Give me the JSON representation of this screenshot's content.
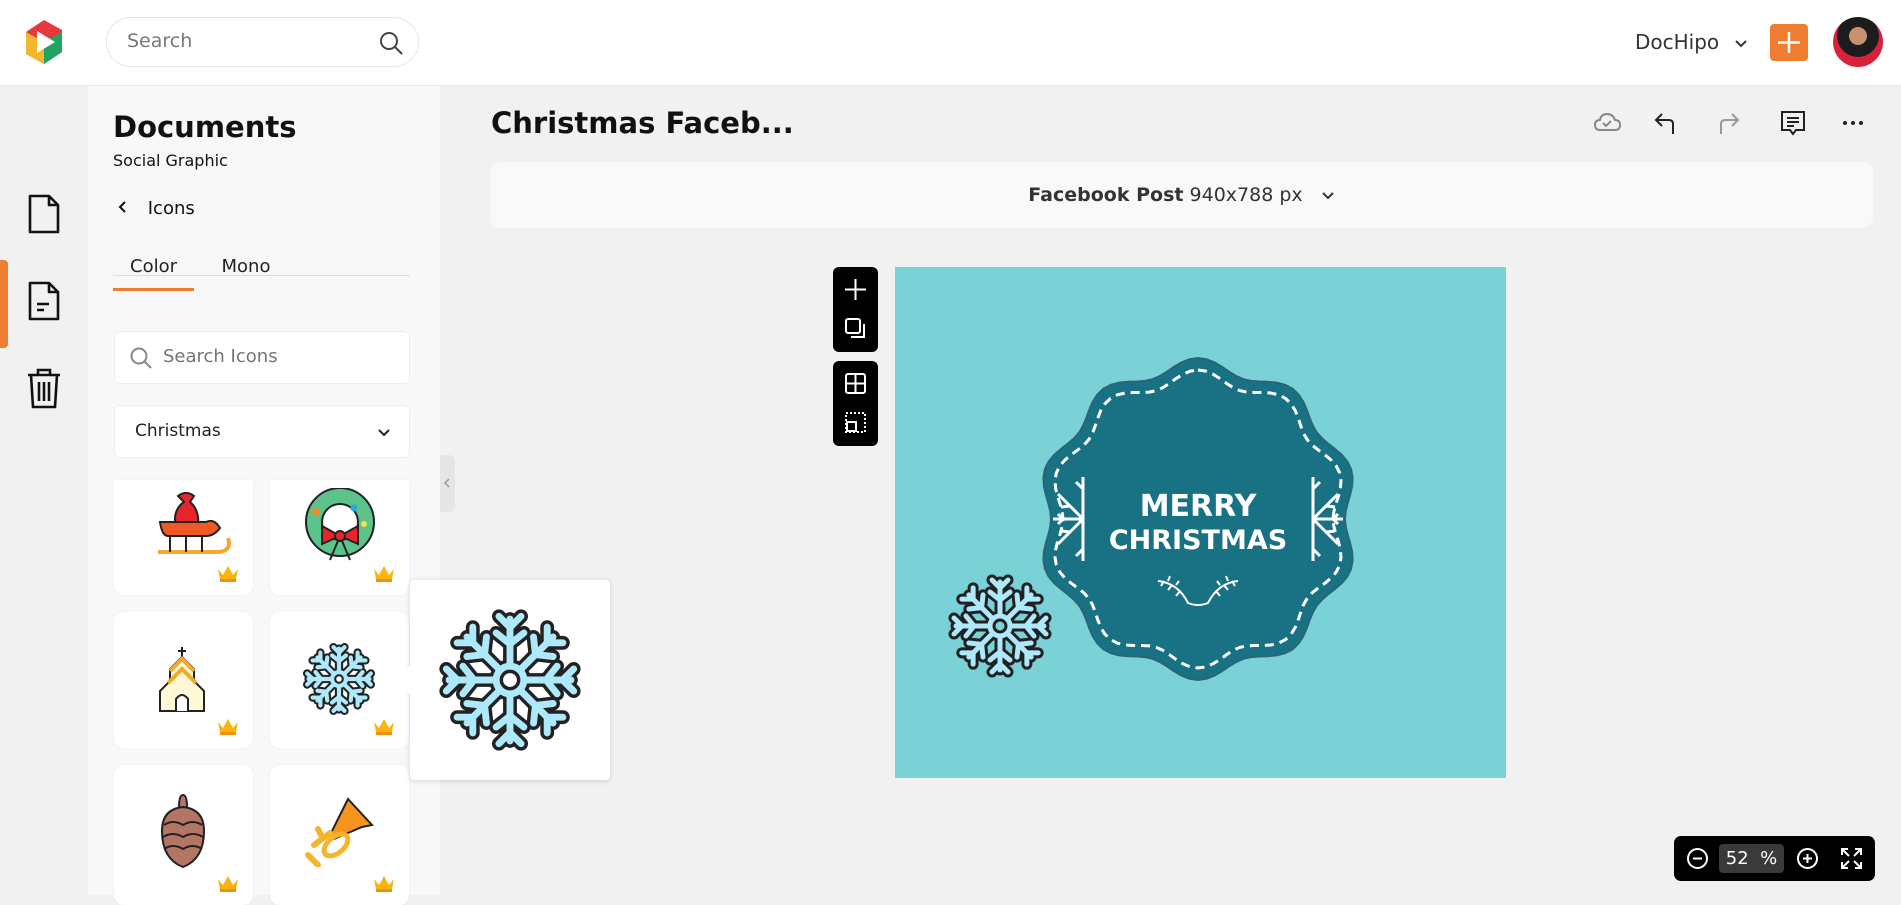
{
  "header": {
    "search_placeholder": "Search",
    "workspace": "DocHipo",
    "brand_color": "#ef7d31"
  },
  "rail": {
    "items": [
      {
        "icon": "document-icon"
      },
      {
        "icon": "document-lines-icon",
        "active": true
      },
      {
        "icon": "trash-icon"
      }
    ]
  },
  "panel": {
    "title": "Documents",
    "subtitle": "Social Graphic",
    "back_label": "Icons",
    "tabs": [
      {
        "label": "Color",
        "active": true
      },
      {
        "label": "Mono"
      }
    ],
    "search_placeholder": "Search Icons",
    "category": "Christmas",
    "icons": [
      "sleigh",
      "wreath",
      "church",
      "snowflake",
      "pinecone",
      "trumpet"
    ]
  },
  "editor": {
    "doc_title": "Christmas Faceb...",
    "format_name": "Facebook Post",
    "format_size": "940x788 px",
    "zoom_value": "52",
    "zoom_unit": "%"
  },
  "design": {
    "line1": "MERRY",
    "line2": "CHRISTMAS",
    "background": "#7ad1d6",
    "badge_color": "#187284"
  }
}
